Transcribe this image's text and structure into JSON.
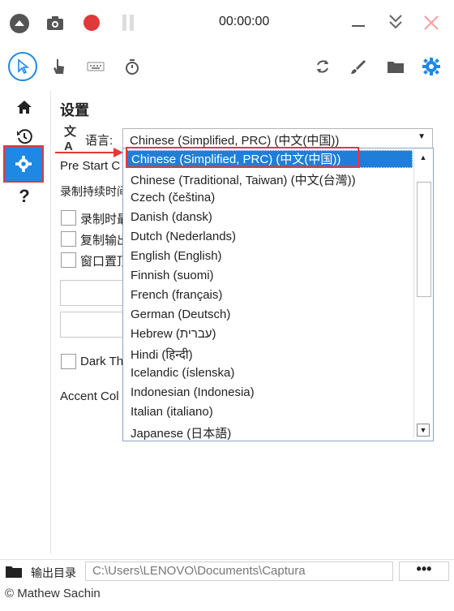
{
  "topbar": {
    "timer": "00:00:00"
  },
  "settings": {
    "title": "设置",
    "language_label": "语言:",
    "language_selected": "Chinese (Simplified, PRC) (中文(中国))",
    "pre_start_label": "Pre Start C",
    "record_duration_label": "录制持续时间",
    "checkbox1": "录制时最",
    "checkbox2": "复制输出",
    "checkbox3": "窗口置顶",
    "dark_theme": "Dark Th",
    "accent_color": "Accent Col"
  },
  "language_options": [
    "Chinese (Simplified, PRC) (中文(中国))",
    "Chinese (Traditional, Taiwan) (中文(台灣))",
    "Czech (čeština)",
    "Danish (dansk)",
    "Dutch (Nederlands)",
    "English (English)",
    "Finnish (suomi)",
    "French (français)",
    "German (Deutsch)",
    "Hebrew (עברית)",
    "Hindi (हिन्दी)",
    "Icelandic (íslenska)",
    "Indonesian (Indonesia)",
    "Italian (italiano)",
    "Japanese (日本語)"
  ],
  "output": {
    "label": "输出目录",
    "path": "C:\\Users\\LENOVO\\Documents\\Captura",
    "more": "•••"
  },
  "footer": "© Mathew Sachin",
  "colors": {
    "accent": "#1e88e5",
    "highlight": "#e53935",
    "record": "#e53935"
  }
}
